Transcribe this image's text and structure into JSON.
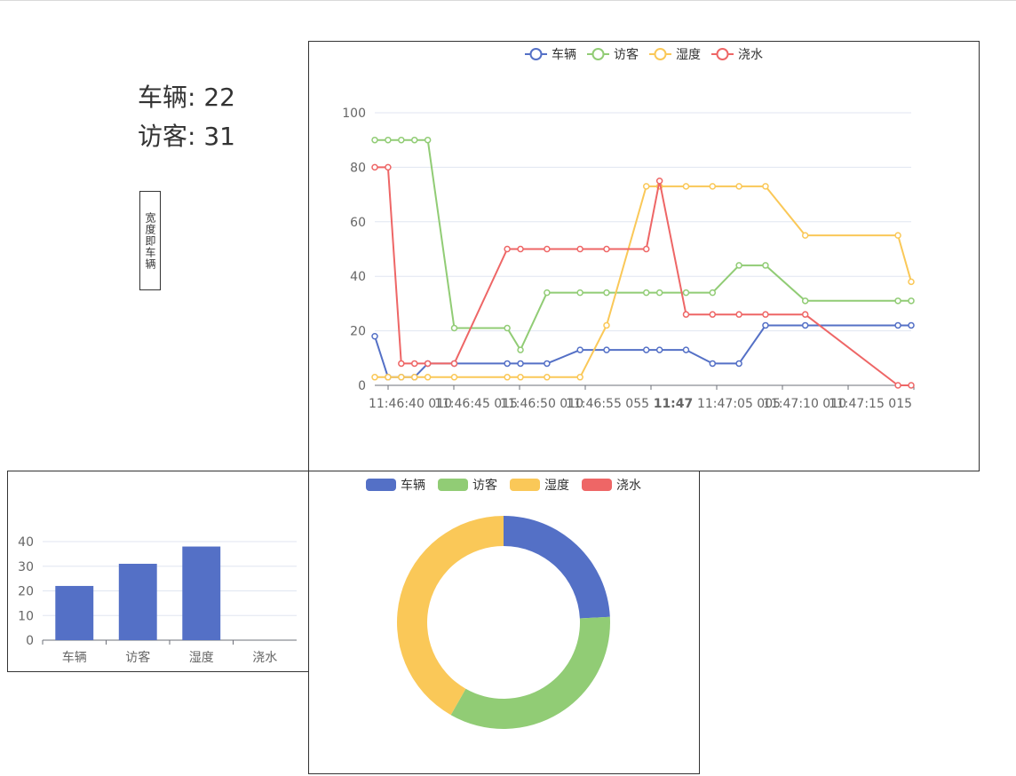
{
  "stats": {
    "vehicles": "车辆: 22",
    "visitors": "访客: 31"
  },
  "vertical_tag": "宽度即车辆",
  "colors": {
    "车辆": "#5470c6",
    "访客": "#91cc75",
    "湿度": "#fac858",
    "浇水": "#ee6666"
  },
  "chart_data": [
    {
      "type": "line",
      "legend": [
        "车辆",
        "访客",
        "湿度",
        "浇水"
      ],
      "legend_position": "top-center",
      "ylim": [
        0,
        100
      ],
      "yticks": [
        0,
        20,
        40,
        60,
        80,
        100
      ],
      "xlim": [
        0,
        81
      ],
      "x_tick_values": [
        4,
        24,
        44,
        64,
        84,
        104,
        124,
        144,
        164
      ],
      "x_tick_labels": [
        "11:46:40 010",
        "11:46:45 015",
        "11:46:50 010",
        "11:46:55 055",
        "11:47",
        "11:47:05 005",
        "11:47:10 010",
        "11:47:15 015",
        ""
      ],
      "x_tick_bold": [
        false,
        false,
        false,
        false,
        true,
        false,
        false,
        false,
        false
      ],
      "grid": true,
      "series": [
        {
          "name": "车辆",
          "points": [
            [
              0,
              18
            ],
            [
              2,
              3
            ],
            [
              4,
              3
            ],
            [
              6,
              3
            ],
            [
              8,
              8
            ],
            [
              12,
              8
            ],
            [
              20,
              8
            ],
            [
              22,
              8
            ],
            [
              26,
              8
            ],
            [
              31,
              13
            ],
            [
              35,
              13
            ],
            [
              41,
              13
            ],
            [
              43,
              13
            ],
            [
              47,
              13
            ],
            [
              51,
              8
            ],
            [
              55,
              8
            ],
            [
              59,
              22
            ],
            [
              65,
              22
            ],
            [
              79,
              22
            ],
            [
              81,
              22
            ]
          ]
        },
        {
          "name": "访客",
          "points": [
            [
              0,
              90
            ],
            [
              2,
              90
            ],
            [
              4,
              90
            ],
            [
              6,
              90
            ],
            [
              8,
              90
            ],
            [
              12,
              21
            ],
            [
              20,
              21
            ],
            [
              22,
              13
            ],
            [
              26,
              34
            ],
            [
              31,
              34
            ],
            [
              35,
              34
            ],
            [
              41,
              34
            ],
            [
              43,
              34
            ],
            [
              47,
              34
            ],
            [
              51,
              34
            ],
            [
              55,
              44
            ],
            [
              59,
              44
            ],
            [
              65,
              31
            ],
            [
              79,
              31
            ],
            [
              81,
              31
            ]
          ]
        },
        {
          "name": "湿度",
          "points": [
            [
              0,
              3
            ],
            [
              2,
              3
            ],
            [
              4,
              3
            ],
            [
              6,
              3
            ],
            [
              8,
              3
            ],
            [
              12,
              3
            ],
            [
              20,
              3
            ],
            [
              22,
              3
            ],
            [
              26,
              3
            ],
            [
              31,
              3
            ],
            [
              35,
              22
            ],
            [
              41,
              73
            ],
            [
              43,
              73
            ],
            [
              47,
              73
            ],
            [
              51,
              73
            ],
            [
              55,
              73
            ],
            [
              59,
              73
            ],
            [
              65,
              55
            ],
            [
              79,
              55
            ],
            [
              81,
              38
            ]
          ]
        },
        {
          "name": "浇水",
          "points": [
            [
              0,
              80
            ],
            [
              2,
              80
            ],
            [
              4,
              8
            ],
            [
              6,
              8
            ],
            [
              8,
              8
            ],
            [
              12,
              8
            ],
            [
              20,
              50
            ],
            [
              22,
              50
            ],
            [
              26,
              50
            ],
            [
              31,
              50
            ],
            [
              35,
              50
            ],
            [
              41,
              50
            ],
            [
              43,
              75
            ],
            [
              47,
              26
            ],
            [
              51,
              26
            ],
            [
              55,
              26
            ],
            [
              59,
              26
            ],
            [
              65,
              26
            ],
            [
              79,
              0
            ],
            [
              81,
              0
            ]
          ]
        }
      ]
    },
    {
      "type": "bar",
      "categories": [
        "车辆",
        "访客",
        "湿度",
        "浇水"
      ],
      "values": [
        22,
        31,
        38,
        0
      ],
      "ylim": [
        0,
        40
      ],
      "yticks": [
        0,
        10,
        20,
        30,
        40
      ],
      "grid": true
    },
    {
      "type": "pie",
      "style": "donut",
      "legend": [
        "车辆",
        "访客",
        "湿度",
        "浇水"
      ],
      "legend_position": "top-center",
      "labels": [
        "车辆",
        "访客",
        "湿度",
        "浇水"
      ],
      "values": [
        22,
        31,
        38,
        0
      ]
    }
  ]
}
